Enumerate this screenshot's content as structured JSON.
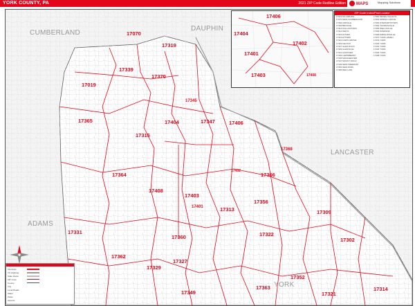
{
  "header": {
    "title": "YORK COUNTY, PA",
    "subtitle": "2021 ZIP Code Redline Edition",
    "logo_text": "Mapping Solutions"
  },
  "neighbor_counties": [
    {
      "name": "CUMBERLAND"
    },
    {
      "name": "DAUPHIN"
    },
    {
      "name": "LANCASTER"
    },
    {
      "name": "ADAMS"
    },
    {
      "name": "YORK"
    }
  ],
  "zip_labels": [
    "17070",
    "17319",
    "17339",
    "17370",
    "17019",
    "17345",
    "17365",
    "17404",
    "17347",
    "17406",
    "17315",
    "17368",
    "17364",
    "17366",
    "17408",
    "17402",
    "17403",
    "17401",
    "17313",
    "17356",
    "17309",
    "17331",
    "17360",
    "17322",
    "17302",
    "17362",
    "17329",
    "17327",
    "17352",
    "17363",
    "17349",
    "17321",
    "17314"
  ],
  "inset": {
    "zips": [
      "17406",
      "17404",
      "17402",
      "17401",
      "17403",
      "17408"
    ]
  },
  "index_table": {
    "title": "ZIP Code Index/Post Locator",
    "left_col": [
      "17019 DILLSBURG",
      "17070 NEW CUMBERLAND",
      "17302 AIRVILLE",
      "17309 BROGUE",
      "17313 DALLASTOWN",
      "17314 DELTA",
      "17315 DOVER",
      "17319 ETTERS",
      "17321 FAWN GROVE",
      "17322 FELTON",
      "17327 GLEN ROCK",
      "17329 GLENVILLE",
      "17331 HANOVER",
      "17339 LEWISBERRY",
      "17345 MANCHESTER",
      "17347 MOUNT WOLF",
      "17349 NEW FREEDOM",
      "17352 NEW PARK",
      "17356 RED LION"
    ],
    "right_col": [
      "17360 SEVEN VALLEYS",
      "17362 SPRING GROVE",
      "17363 STEWARTSTOWN",
      "17364 THOMASVILLE",
      "17365 WELLSVILLE",
      "17366 WINDSOR",
      "17368 WRIGHTSVILLE",
      "17370 YORK HAVEN",
      "17401 YORK",
      "17402 YORK",
      "17403 YORK",
      "17404 YORK",
      "17406 YORK",
      "17408 YORK"
    ]
  },
  "legend": {
    "rows": [
      "Interstate",
      "US Highway",
      "State Route",
      "ZIP Code",
      "County",
      "City",
      "Local Roads",
      "Water",
      "Parks",
      "Airports"
    ]
  },
  "colors": {
    "accent": "#e3061b",
    "zip_boundary": "#e3061b",
    "roads": "#b7b7b7",
    "background": "#f4f4f4"
  },
  "icons": [
    "compass-icon",
    "mapping-solutions-logo"
  ]
}
